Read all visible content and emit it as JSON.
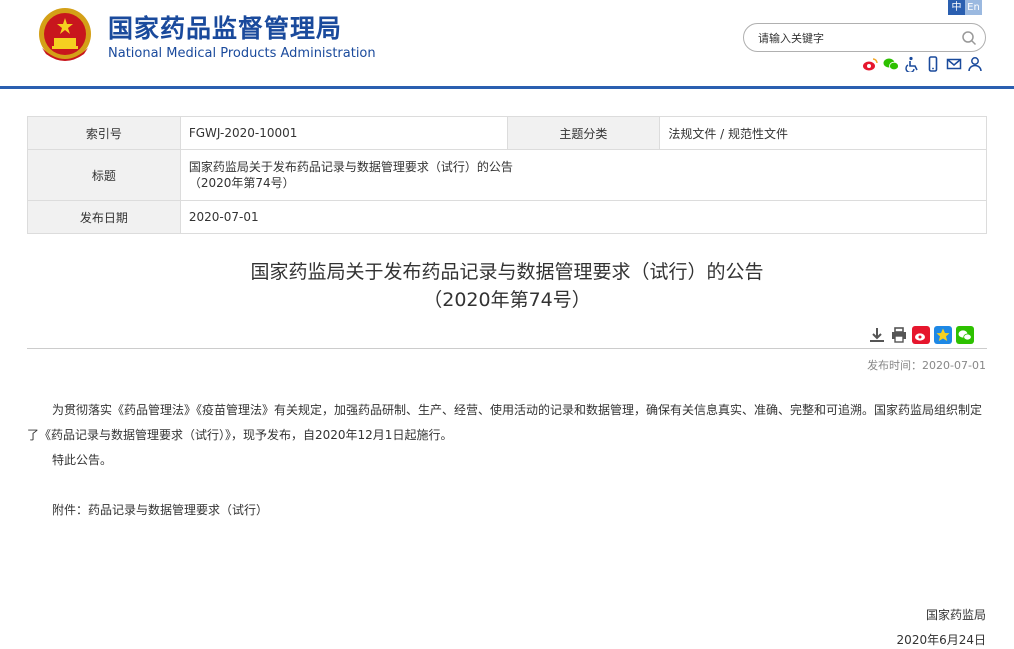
{
  "header": {
    "site_title_cn": "国家药品监督管理局",
    "site_title_en": "National Medical Products Administration",
    "lang": {
      "zh": "中",
      "en": "En"
    },
    "search": {
      "placeholder": "请输入关键字"
    },
    "share_icons": [
      "weibo-icon",
      "wechat-icon",
      "accessibility-icon",
      "mobile-icon",
      "mail-icon",
      "user-icon"
    ]
  },
  "info": {
    "index_label": "索引号",
    "index_value": "FGWJ-2020-10001",
    "category_label": "主题分类",
    "category_value": "法规文件 / 规范性文件",
    "title_label": "标题",
    "title_value_line1": "国家药监局关于发布药品记录与数据管理要求（试行）的公告",
    "title_value_line2": "（2020年第74号）",
    "date_label": "发布日期",
    "date_value": "2020-07-01"
  },
  "article": {
    "title_line1": "国家药监局关于发布药品记录与数据管理要求（试行）的公告",
    "title_line2": "（2020年第74号）",
    "pubtime": "发布时间：2020-07-01",
    "paragraph1": "为贯彻落实《药品管理法》《疫苗管理法》有关规定，加强药品研制、生产、经营、使用活动的记录和数据管理，确保有关信息真实、准确、完整和可追溯。国家药监局组织制定了《药品记录与数据管理要求（试行）》，现予发布，自2020年12月1日起施行。",
    "paragraph2": "特此公告。",
    "attachment": "附件：药品记录与数据管理要求（试行）",
    "sign_org": "国家药监局",
    "sign_date": "2020年6月24日"
  },
  "colors": {
    "brand_blue": "#1a4a9c",
    "bar_blue": "#2a5fb0",
    "weibo_red": "#e6162d",
    "wechat_green": "#2dc100",
    "favorite_blue": "#1e88e5"
  }
}
